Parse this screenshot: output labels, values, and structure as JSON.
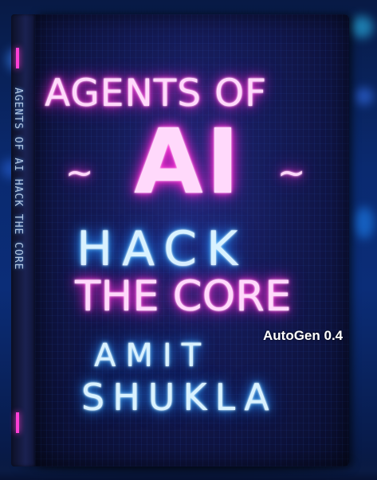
{
  "book": {
    "title_line1": "AGENTS OF",
    "title_ai": "AI",
    "tilde": "~",
    "title_line3": "HACK",
    "title_line4": "THE CORE",
    "author_first": "AMIT",
    "author_last": "SHUKLA",
    "spine_text": "AGENTS OF AI HACK THE CORE"
  },
  "overlay": {
    "label": "AutoGen 0.4"
  },
  "colors": {
    "neon_pink": "#ff2bd0",
    "neon_blue": "#2ea0ff",
    "background": "#0b2d78"
  }
}
